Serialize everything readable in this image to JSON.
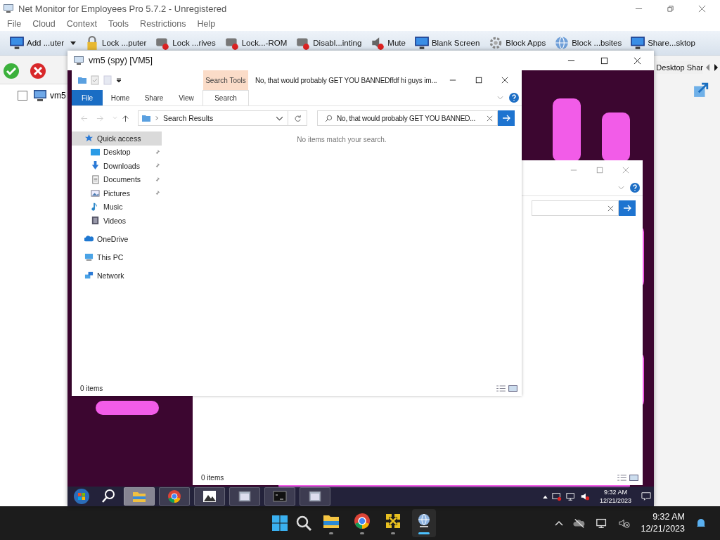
{
  "window": {
    "title": "Net Monitor for Employees Pro 5.7.2 - Unregistered"
  },
  "menu": [
    "File",
    "Cloud",
    "Context",
    "Tools",
    "Restrictions",
    "Help"
  ],
  "toolbar": [
    {
      "label": "Add ...uter",
      "kind": "dropdown"
    },
    {
      "label": "Lock ...puter",
      "kind": "button"
    },
    {
      "label": "Lock ...rives",
      "kind": "button"
    },
    {
      "label": "Lock...-ROM",
      "kind": "button"
    },
    {
      "label": "Disabl...inting",
      "kind": "button"
    },
    {
      "label": "Mute",
      "kind": "button"
    },
    {
      "label": "Blank Screen",
      "kind": "button"
    },
    {
      "label": "Block Apps",
      "kind": "button"
    },
    {
      "label": "Block ...bsites",
      "kind": "button"
    },
    {
      "label": "Share...sktop",
      "kind": "button"
    }
  ],
  "computers": [
    {
      "name": "vm5",
      "checked": false
    }
  ],
  "view_tab": {
    "label": "Desktop Shar"
  },
  "spy_window": {
    "title": "vm5 (spy) [VM5]"
  },
  "explorer": {
    "title": "No, that would probably GET YOU BANNEDffdf hi guys im...",
    "contextual_tab": "Search Tools",
    "ribbon_tabs": [
      {
        "label": "File",
        "kind": "file",
        "selected": false
      },
      {
        "label": "Home",
        "kind": "tab",
        "selected": false
      },
      {
        "label": "Share",
        "kind": "tab",
        "selected": false
      },
      {
        "label": "View",
        "kind": "tab",
        "selected": false
      },
      {
        "label": "Search",
        "kind": "tab",
        "selected": true
      }
    ],
    "address": "Search Results",
    "search_value": "No, that would probably GET YOU BANNED...",
    "empty_message": "No items match your search.",
    "nav": [
      {
        "label": "Quick access",
        "selected": true,
        "children": [
          {
            "label": "Desktop",
            "pinned": true,
            "selected": false
          },
          {
            "label": "Downloads",
            "pinned": true,
            "selected": false
          },
          {
            "label": "Documents",
            "pinned": true,
            "selected": false
          },
          {
            "label": "Pictures",
            "pinned": true,
            "selected": false
          },
          {
            "label": "Music",
            "pinned": false,
            "selected": false
          },
          {
            "label": "Videos",
            "pinned": false,
            "selected": false
          }
        ]
      },
      {
        "label": "OneDrive",
        "selected": false
      },
      {
        "label": "This PC",
        "selected": false
      },
      {
        "label": "Network",
        "selected": false
      }
    ],
    "status": "0 items"
  },
  "explorer_behind": {
    "status": "0 items"
  },
  "remote_taskbar": {
    "apps": [
      {
        "selected": true
      },
      {
        "selected": false
      },
      {
        "selected": false
      },
      {
        "selected": false
      },
      {
        "selected": false
      },
      {
        "selected": false
      }
    ],
    "time": "9:32 AM",
    "date": "12/21/2023"
  },
  "host_taskbar": {
    "apps": [
      {
        "selected": false
      },
      {
        "selected": false
      },
      {
        "selected": false
      },
      {
        "selected": true
      }
    ],
    "time": "9:32 AM",
    "date": "12/21/2023"
  }
}
